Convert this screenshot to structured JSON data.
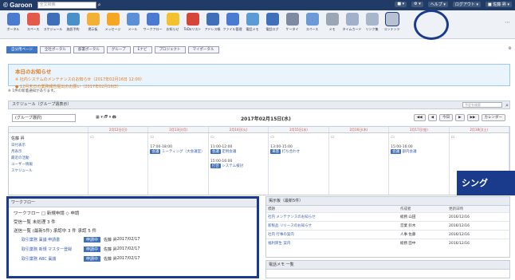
{
  "topbar": {
    "logo": "© Garoon",
    "search_placeholder": "全文検索",
    "right_items": [
      "■ ▾",
      "⚙ ▾",
      "ヘルプ ▾",
      "ログアウト ▾",
      "■ 佐藤 昇 ▾"
    ]
  },
  "apps": [
    {
      "label": "ポータル",
      "color": "#4a7bd1"
    },
    {
      "label": "スペース",
      "color": "#e25b4a"
    },
    {
      "label": "スケジュール",
      "color": "#3f6fb8"
    },
    {
      "label": "施設予約",
      "color": "#4a90c8"
    },
    {
      "label": "掲示板",
      "color": "#f2b134"
    },
    {
      "label": "メッセージ",
      "color": "#f5a623"
    },
    {
      "label": "メール",
      "color": "#5b8fd6"
    },
    {
      "label": "ワークフロー",
      "color": "#4a7bd1"
    },
    {
      "label": "お知らせ",
      "color": "#f2c12e"
    },
    {
      "label": "ToDoリスト",
      "color": "#d4453a"
    },
    {
      "label": "アドレス帳",
      "color": "#3f6fb8"
    },
    {
      "label": "ファイル管理",
      "color": "#4a7bd1"
    },
    {
      "label": "電話メモ",
      "color": "#5a9bd5"
    },
    {
      "label": "電話ログ",
      "color": "#3f6fb8"
    },
    {
      "label": "ケータイ",
      "color": "#7d8aa0"
    },
    {
      "label": "スペース",
      "color": "#6a9ad8"
    },
    {
      "label": "メモ",
      "color": "#9aa5b5"
    },
    {
      "label": "タイムカード",
      "color": "#9fb0c8"
    },
    {
      "label": "リンク集",
      "color": "#a8b6c9"
    },
    {
      "label": "コンテンツ",
      "color": "#b6c2d2"
    }
  ],
  "tabs": [
    "自分用ページ",
    "全社ポータル",
    "部署ポータル",
    "グループ",
    "Eナビ",
    "プロジェクト",
    "マイポータル"
  ],
  "tabs_right": "⚙",
  "notice": {
    "title": "本日のお知らせ",
    "lines": [
      "※ 社内システムのメンテナンスのお知らせ（2017年02月16日 12:00）",
      "● 12月末日の業務報告提出のお願い（2017年02月16日）"
    ]
  },
  "subinfo": "※ 1件の新着通知があります。",
  "schedule": {
    "header": "スケジュール（グループ週表示）",
    "search_placeholder": "予定を検索",
    "group_select": "(グループ選択)",
    "tool_buttons": "▦ ▾ 🗗 ▾ 🖨",
    "date": "2017年02月15日(水)",
    "nav": [
      "◀◀",
      "◀",
      "今日",
      "▶",
      "▶▶",
      "カレンダー"
    ],
    "days": [
      "2月12日(日)",
      "2月13日(月)",
      "2月14日(火)",
      "2月15日(水)",
      "2月16日(木)",
      "2月17日(金)",
      "2月18日(土)"
    ],
    "user": {
      "name": "佐藤 昇",
      "links": [
        "日付表示",
        "月表示",
        "最近の活動",
        "ユーザー情報",
        "スケジュール"
      ]
    },
    "events": [
      {
        "day": 1,
        "time": "17:00-18:00",
        "tag": "会議",
        "title": "ミーティング（大会議室）"
      },
      {
        "day": 2,
        "time": "11:00-12:00",
        "tag": "会議",
        "title": "定例会議"
      },
      {
        "day": 2,
        "time": "15:00-16:00",
        "tag": "打合",
        "title": "システム検討"
      },
      {
        "day": 3,
        "time": "13:00-15:00",
        "tag": "来客",
        "title": "打ち合わせ"
      },
      {
        "day": 5,
        "time": "15:00-16:00",
        "tag": "会議",
        "title": "部内会議"
      }
    ]
  },
  "banner": "シング",
  "workflow": {
    "header": "ワークフロー",
    "line1": "ワークフロー  □ 新規申請  ◇ 申請",
    "line2": "受信一覧  未処理 3 件",
    "line3": "送信一覧  (最新5件)  承認中 3 件  承認 5 件",
    "rows": [
      {
        "name": "取引業務 稟議 申請書",
        "badge": "申請中",
        "who": "佐藤 昇",
        "date": "2017/02/17"
      },
      {
        "name": "取引業務 新規 マスター登録",
        "badge": "申請中",
        "who": "佐藤 昇",
        "date": "2017/02/17"
      },
      {
        "name": "取引業務 ABC 稟議",
        "badge": "申請中",
        "who": "佐藤 昇",
        "date": "2017/02/17"
      }
    ]
  },
  "board": {
    "header": "掲示板（最新5件）",
    "columns": [
      "標題",
      "作成者",
      "更新日時"
    ],
    "rows": [
      {
        "subject": "社内 メンテナンスのお知らせ",
        "author": "総務 山田",
        "date": "2016/12/16"
      },
      {
        "subject": "新製品 リリースのお知らせ",
        "author": "営業 鈴木",
        "date": "2016/12/16"
      },
      {
        "subject": "社内 行事の案内",
        "author": "人事 佐藤",
        "date": "2016/12/16"
      },
      {
        "subject": "福利厚生 案内",
        "author": "総務 田中",
        "date": "2016/12/16"
      }
    ]
  },
  "board2": {
    "header": "電話メモ 一覧"
  }
}
